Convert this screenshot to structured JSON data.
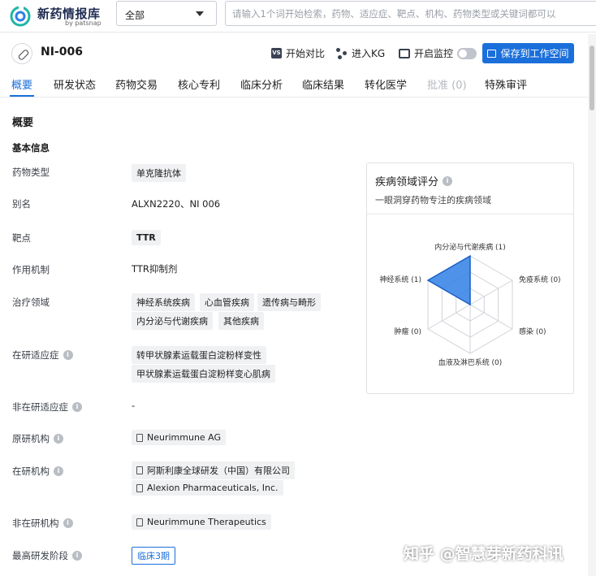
{
  "app": {
    "logo_title": "新药情报库",
    "logo_sub": "by patsnap",
    "scope_value": "全部",
    "search_placeholder": "请输入1个词开始检索，药物、适应症、靶点、机构、药物类型或关键词都可以"
  },
  "header": {
    "drug_name": "NI-006",
    "compare": "开始对比",
    "kg": "进入KG",
    "monitor": "开启监控",
    "save": "保存到工作空间"
  },
  "tabs": [
    "概要",
    "研发状态",
    "药物交易",
    "核心专利",
    "临床分析",
    "临床结果",
    "转化医学",
    "批准 (0)",
    "特殊审评"
  ],
  "overview": {
    "title": "概要",
    "basic_info": "基本信息",
    "fields": {
      "drug_type_label": "药物类型",
      "drug_type": "单克隆抗体",
      "alias_label": "别名",
      "alias": "ALXN2220、NI 006",
      "target_label": "靶点",
      "target": "TTR",
      "mechanism_label": "作用机制",
      "mechanism": "TTR抑制剂",
      "therapeutic_label": "治疗领域",
      "therapeutic": [
        "神经系统疾病",
        "心血管疾病",
        "遗传病与畸形",
        "内分泌与代谢疾病",
        "其他疾病"
      ],
      "active_ind_label": "在研适应症",
      "active_ind": [
        "转甲状腺素运载蛋白淀粉样变性",
        "甲状腺素运载蛋白淀粉样变心肌病"
      ],
      "inactive_ind_label": "非在研适应症",
      "inactive_ind": "-",
      "originator_label": "原研机构",
      "originator": "Neurimmune AG",
      "active_org_label": "在研机构",
      "active_org": [
        "阿斯利康全球研发（中国）有限公司",
        "Alexion Pharmaceuticals, Inc."
      ],
      "inactive_org_label": "非在研机构",
      "inactive_org": "Neurimmune Therapeutics",
      "highest_phase_label": "最高研发阶段",
      "highest_phase": "临床3期"
    }
  },
  "disease_card": {
    "title": "疾病领域评分",
    "subtitle": "一眼洞穿药物专注的疾病领域",
    "axes": [
      {
        "label": "内分泌与代谢疾病 (1)",
        "value": 1
      },
      {
        "label": "免疫系统 (0)",
        "value": 0
      },
      {
        "label": "感染 (0)",
        "value": 0
      },
      {
        "label": "血液及淋巴系统 (0)",
        "value": 0
      },
      {
        "label": "肿瘤 (0)",
        "value": 0
      },
      {
        "label": "神经系统 (1)",
        "value": 1
      }
    ],
    "max": 1,
    "fill_color": "#2f7fe6"
  },
  "watermark": "知乎 @智慧芽新药科讯"
}
